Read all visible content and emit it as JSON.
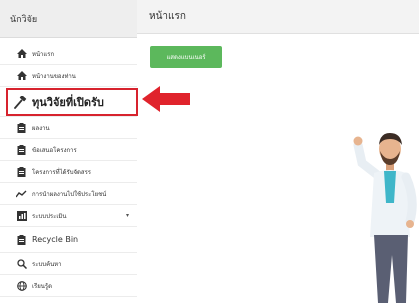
{
  "sidebar": {
    "title": "นักวิจัย",
    "items": [
      {
        "label": "หน้าแรก",
        "icon": "home-icon"
      },
      {
        "label": "หน้างานของท่าน",
        "icon": "home-icon"
      },
      {
        "label": "ทุนวิจัยที่เปิดรับ",
        "icon": "gavel-icon",
        "highlighted": true
      },
      {
        "label": "ผลงาน",
        "icon": "clipboard-icon"
      },
      {
        "label": "ข้อเสนอโครงการ",
        "icon": "clipboard-icon"
      },
      {
        "label": "โครงการที่ได้รับจัดสรร",
        "icon": "clipboard-icon"
      },
      {
        "label": "การนำผลงานไปใช้ประโยชน์",
        "icon": "line-chart-icon"
      },
      {
        "label": "ระบบประเมิน",
        "icon": "bar-chart-icon",
        "has_submenu": true
      },
      {
        "label": "Recycle Bin",
        "icon": "clipboard-icon"
      },
      {
        "label": "ระบบค้นหา",
        "icon": "search-icon"
      },
      {
        "label": "เรียนรู้ด",
        "icon": "globe-icon"
      }
    ]
  },
  "main": {
    "title": "หน้าแรก",
    "action_button": "แสดงแบนเนอร์"
  },
  "colors": {
    "highlight_border": "#d7232e",
    "arrow": "#e0232c",
    "button": "#5cb85c"
  }
}
